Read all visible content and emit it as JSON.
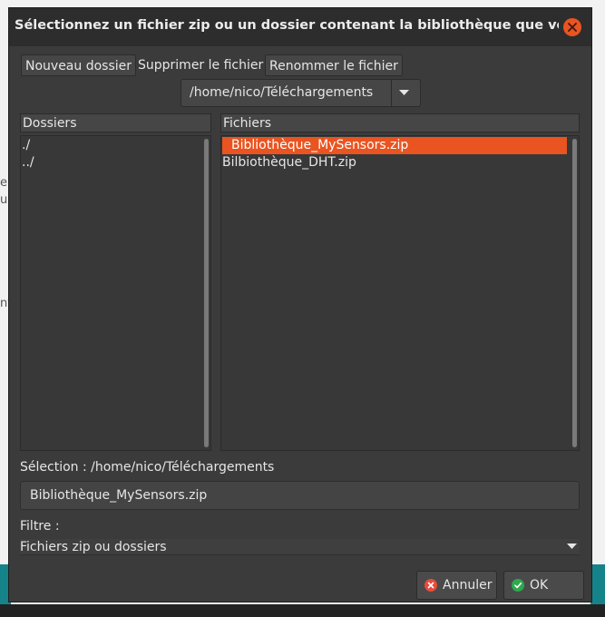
{
  "dialog": {
    "title": "Sélectionnez un fichier zip ou un dossier contenant la bibliothèque que vous souh…"
  },
  "toolbar": {
    "new_folder": "Nouveau dossier",
    "delete_file": "Supprimer le fichier",
    "rename_file": "Renommer le fichier"
  },
  "path": {
    "current": "/home/nico/Téléchargements"
  },
  "folders": {
    "header": "Dossiers",
    "items": [
      "./",
      "../"
    ]
  },
  "files": {
    "header": "Fichiers",
    "items": [
      "Bibliothèque_MySensors.zip",
      "Bilbiothèque_DHT.zip"
    ],
    "selected_index": 0
  },
  "selection": {
    "label": "Sélection : /home/nico/Téléchargements",
    "value": "Bibliothèque_MySensors.zip"
  },
  "filter": {
    "label": "Filtre :",
    "selected": "Fichiers zip ou dossiers"
  },
  "actions": {
    "cancel": "Annuler",
    "ok": "OK"
  },
  "background": {
    "fragments": [
      "e",
      "ur",
      "nt"
    ]
  },
  "colors": {
    "accent": "#e95420",
    "ok_icon": "#2fa84f",
    "cancel_icon": "#e74c3c"
  }
}
